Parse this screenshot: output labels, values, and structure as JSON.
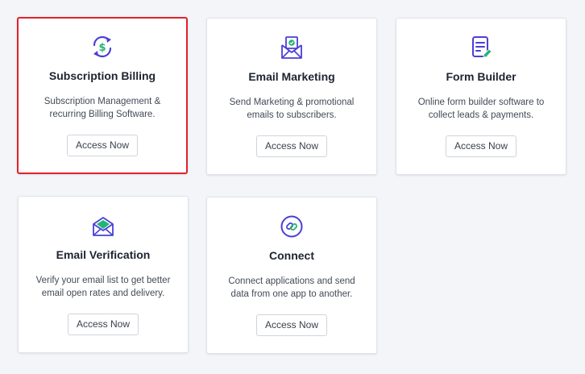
{
  "colors": {
    "accent_purple": "#4b3fd6",
    "accent_green": "#22b573",
    "selected_border": "#e0222b"
  },
  "cards": [
    {
      "title": "Subscription Billing",
      "description": "Subscription Management & recurring Billing Software.",
      "button": "Access Now",
      "icon": "billing-cycle-icon",
      "selected": true
    },
    {
      "title": "Email Marketing",
      "description": "Send Marketing & promotional emails to subscribers.",
      "button": "Access Now",
      "icon": "email-marketing-icon",
      "selected": false
    },
    {
      "title": "Form Builder",
      "description": "Online form builder software to collect leads & payments.",
      "button": "Access Now",
      "icon": "form-icon",
      "selected": false
    },
    {
      "title": "Email Verification",
      "description": "Verify your email list to get better email open rates and delivery.",
      "button": "Access Now",
      "icon": "email-verification-icon",
      "selected": false
    },
    {
      "title": "Connect",
      "description": "Connect applications and send data from one app to another.",
      "button": "Access Now",
      "icon": "connect-link-icon",
      "selected": false
    }
  ]
}
